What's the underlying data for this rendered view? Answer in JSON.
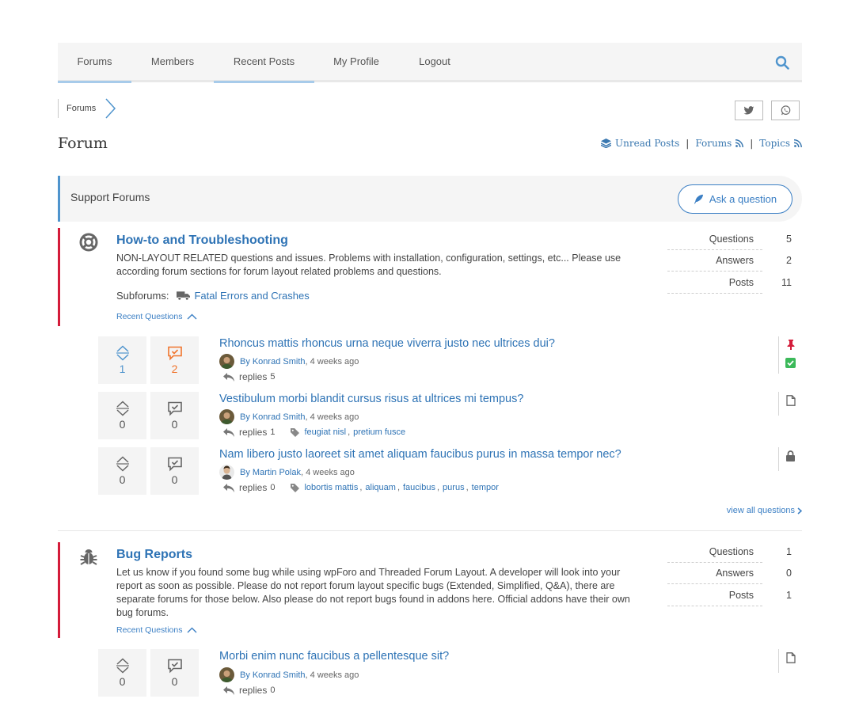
{
  "nav": {
    "items": [
      {
        "label": "Forums",
        "active": true
      },
      {
        "label": "Members",
        "active": false
      },
      {
        "label": "Recent Posts",
        "active": true
      },
      {
        "label": "My Profile",
        "active": false
      },
      {
        "label": "Logout",
        "active": false
      }
    ]
  },
  "breadcrumb": {
    "label": "Forums"
  },
  "page": {
    "title": "Forum"
  },
  "feeds": {
    "unread": "Unread Posts",
    "forums": "Forums",
    "topics": "Topics",
    "sep": "|"
  },
  "support": {
    "label": "Support Forums",
    "ask_label": "Ask a question"
  },
  "forums": [
    {
      "title": "How-to and Troubleshooting",
      "description": "NON-LAYOUT RELATED questions and issues. Problems with installation, configuration, settings, etc... Please use according forum sections for forum layout related problems and questions.",
      "subforums_label": "Subforums:",
      "subforum": "Fatal Errors and Crashes",
      "recent_label": "Recent Questions",
      "stats": [
        {
          "label": "Questions",
          "value": "5"
        },
        {
          "label": "Answers",
          "value": "2"
        },
        {
          "label": "Posts",
          "value": "11"
        }
      ],
      "questions": [
        {
          "votes": "1",
          "answers": "2",
          "title": "Rhoncus mattis rhoncus urna neque viverra justo nec ultrices dui?",
          "by": "By",
          "author": "Konrad Smith",
          "time": "4 weeks ago",
          "replies_label": "replies",
          "replies": "5",
          "tags": [],
          "status": [
            "pin-icon",
            "solved-icon"
          ]
        },
        {
          "votes": "0",
          "answers": "0",
          "title": "Vestibulum morbi blandit cursus risus at ultrices mi tempus?",
          "by": "By",
          "author": "Konrad Smith",
          "time": "4 weeks ago",
          "replies_label": "replies",
          "replies": "1",
          "tags": [
            "feugiat nisl",
            "pretium fusce"
          ],
          "status": [
            "document-icon"
          ]
        },
        {
          "votes": "0",
          "answers": "0",
          "title": "Nam libero justo laoreet sit amet aliquam faucibus purus in massa tempor nec?",
          "by": "By",
          "author": "Martin Polak",
          "time": "4 weeks ago",
          "replies_label": "replies",
          "replies": "0",
          "tags": [
            "lobortis mattis",
            "aliquam",
            "faucibus",
            "purus",
            "tempor"
          ],
          "status": [
            "lock-icon"
          ]
        }
      ],
      "view_all": "view all questions"
    },
    {
      "title": "Bug Reports",
      "description": "Let us know if you found some bug while using wpForo and Threaded Forum Layout. A developer will look into your report as soon as possible. Please do not report forum layout specific bugs (Extended, Simplified, Q&A), there are separate forums for those below. Also please do not report bugs found in addons here. Official addons have their own bug forums.",
      "recent_label": "Recent Questions",
      "stats": [
        {
          "label": "Questions",
          "value": "1"
        },
        {
          "label": "Answers",
          "value": "0"
        },
        {
          "label": "Posts",
          "value": "1"
        }
      ],
      "questions": [
        {
          "votes": "0",
          "answers": "0",
          "title": "Morbi enim nunc faucibus a pellentesque sit?",
          "by": "By",
          "author": "Konrad Smith",
          "time": "4 weeks ago",
          "replies_label": "replies",
          "replies": "0",
          "tags": [],
          "status": [
            "document-icon"
          ]
        }
      ]
    }
  ],
  "colors": {
    "accent": "#2e73b5",
    "forum_bar": "#d41c3a",
    "support_bar": "#4f94cd",
    "answer_orange": "#f0742c",
    "solved_green": "#3cb95a",
    "pin_red": "#d41c3a"
  }
}
